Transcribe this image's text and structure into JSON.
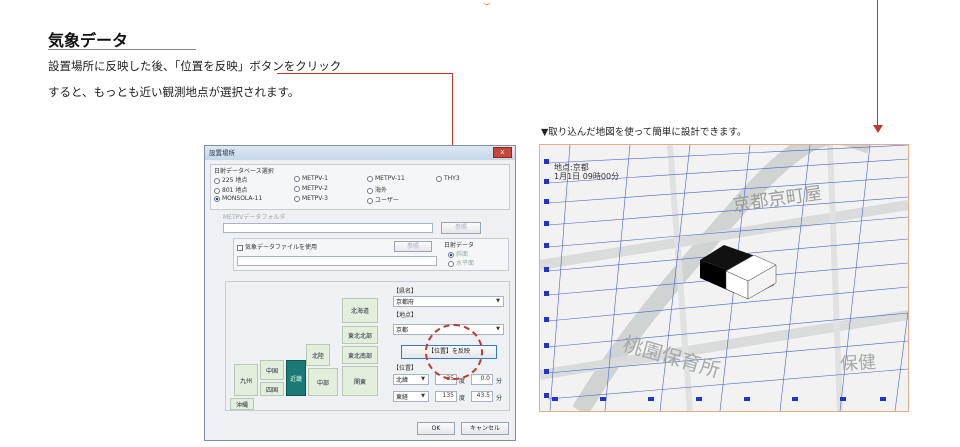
{
  "heading": "気象データ",
  "description": [
    "設置場所に反映した後、「位置を反映」ボタンをクリック",
    "すると、もっとも近い観測地点が選択されます。"
  ],
  "map_caption": "▼取り込んだ地図を使って簡単に設計できます。",
  "dialog": {
    "title": "設置場所",
    "close_label": "x",
    "db_group_label": "日射データベース選択",
    "db_options": [
      {
        "label": "225 地点",
        "selected": false
      },
      {
        "label": "METPV-1",
        "selected": false
      },
      {
        "label": "METPV-11",
        "selected": false
      },
      {
        "label": "THY3",
        "selected": false
      },
      {
        "label": "801 地点",
        "selected": false
      },
      {
        "label": "METPV-2",
        "selected": false
      },
      {
        "label": "海外",
        "selected": false
      },
      {
        "label": "MONSOLA-11",
        "selected": true
      },
      {
        "label": "METPV-3",
        "selected": false
      },
      {
        "label": "ユーザー",
        "selected": false
      }
    ],
    "metpv_folder_label": "METPVデータフォルダ",
    "browse_label": "参照",
    "use_weather_file_label": "気象データファイルを使用",
    "browse_label2": "参照",
    "solar_data_label": "日射データ",
    "solar_opt1": "斜面",
    "solar_opt2": "水平面",
    "regions": [
      "北海道",
      "東北北部",
      "東北南部",
      "北陸",
      "関東",
      "中部",
      "近畿",
      "中国",
      "四国",
      "九州",
      "沖縄"
    ],
    "prefecture_label": "【県名】",
    "prefecture_value": "京都府",
    "point_label": "【地点】",
    "point_value": "京都",
    "reflect_button": "【位置】を反映",
    "position_label": "【位置】",
    "lat_dir": "北緯",
    "lat_deg": "35",
    "deg_unit": "度",
    "lat_min": "0.0",
    "min_unit": "分",
    "lon_dir": "東経",
    "lon_deg": "135",
    "lon_min": "43.5",
    "ok_label": "OK",
    "cancel_label": "キャンセル"
  },
  "map": {
    "location_label": "地点:京都",
    "datetime_label": "1月1日 09時00分",
    "street_labels": [
      "京都京町屋",
      "桃園保育所",
      "保健"
    ]
  }
}
